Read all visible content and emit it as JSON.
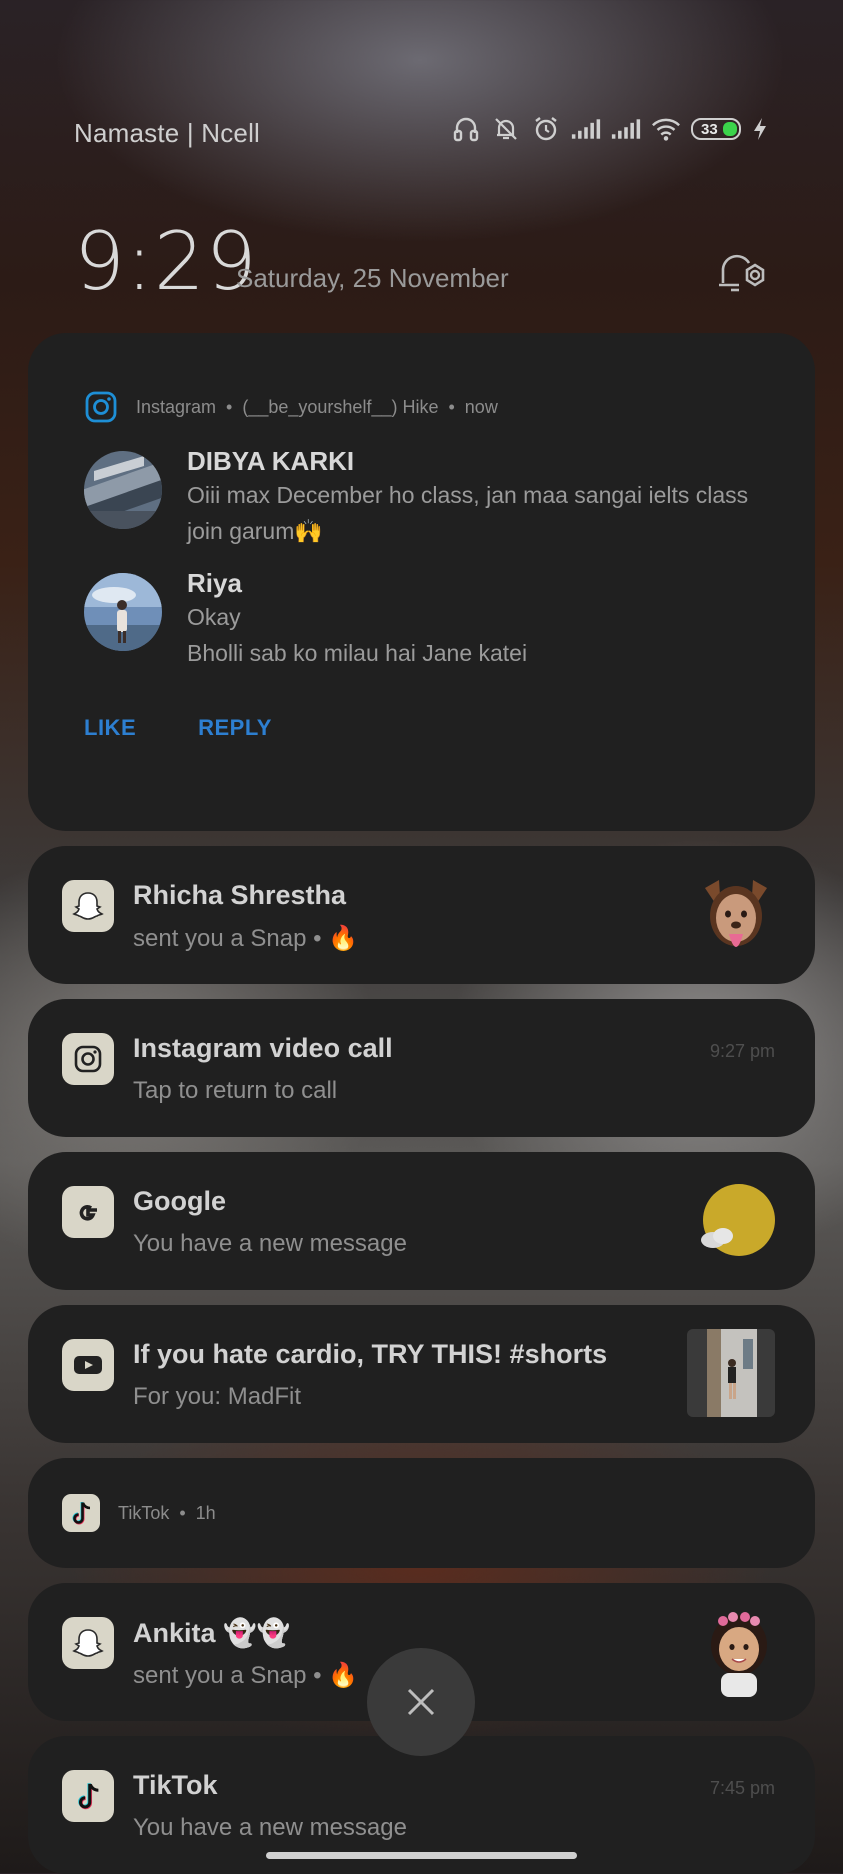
{
  "status_bar": {
    "carrier": "Namaste | Ncell",
    "battery": "33",
    "icons": [
      "headphones-icon",
      "bell-off-icon",
      "alarm-icon",
      "signal-icon",
      "signal-icon",
      "wifi-icon",
      "battery-icon",
      "charging-icon"
    ]
  },
  "clock": {
    "time": "9:29",
    "date": "Saturday, 25 November"
  },
  "instagram_group": {
    "app": "Instagram",
    "account": "(__be_yourshelf__) Hike",
    "time": "now",
    "messages": [
      {
        "name": "DIBYA KARKI",
        "lines": [
          "Oiii max December ho class, jan maa sangai ielts class join garum🙌"
        ]
      },
      {
        "name": "Riya",
        "lines": [
          "Okay",
          "Bholli sab ko milau hai Jane katei"
        ]
      }
    ],
    "actions": {
      "like": "LIKE",
      "reply": "REPLY"
    }
  },
  "notifications": [
    {
      "app": "snapchat",
      "title": "Rhicha Shrestha",
      "subtitle": "sent you a Snap • 🔥",
      "time": ""
    },
    {
      "app": "instagram",
      "title": "Instagram video call",
      "subtitle": "Tap to return to call",
      "time": "9:27 pm"
    },
    {
      "app": "google",
      "title": "Google",
      "subtitle": "You have a new message",
      "time": ""
    },
    {
      "app": "youtube",
      "title": "If you hate cardio, TRY THIS! #shorts",
      "subtitle": "For you: MadFit",
      "time": ""
    }
  ],
  "tiktok_group": {
    "app": "TikTok",
    "time": "1h"
  },
  "notifications2": [
    {
      "app": "snapchat",
      "title": "Ankita 👻👻",
      "subtitle": "sent you a Snap • 🔥",
      "time": ""
    },
    {
      "app": "tiktok",
      "title": "TikTok",
      "subtitle": "You have a new message",
      "time": "7:45 pm"
    }
  ],
  "colors": {
    "accent": "#2d7fd1",
    "card": "#202020",
    "battery_fill": "#3bd34b"
  }
}
